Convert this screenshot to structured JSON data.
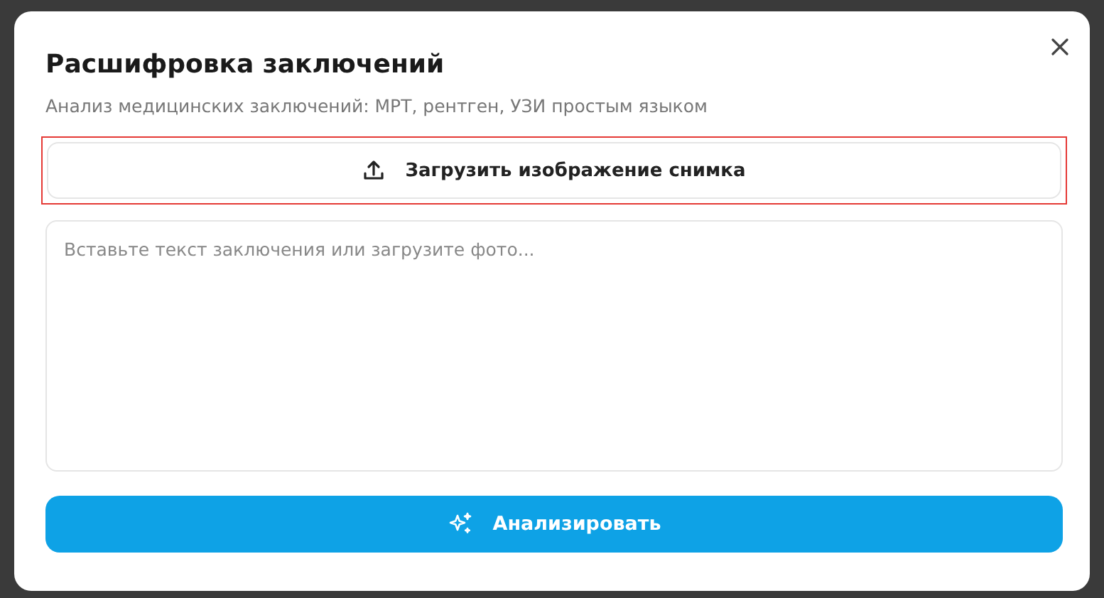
{
  "dialog": {
    "title": "Расшифровка заключений",
    "subtitle": "Анализ медицинских заключений: МРТ, рентген, УЗИ простым языком",
    "upload_button": {
      "label": "Загрузить изображение снимка",
      "highlighted": true
    },
    "report_field": {
      "placeholder": "Вставьте текст заключения или загрузите фото..."
    },
    "analyze_button": {
      "label": "Анализировать"
    }
  }
}
